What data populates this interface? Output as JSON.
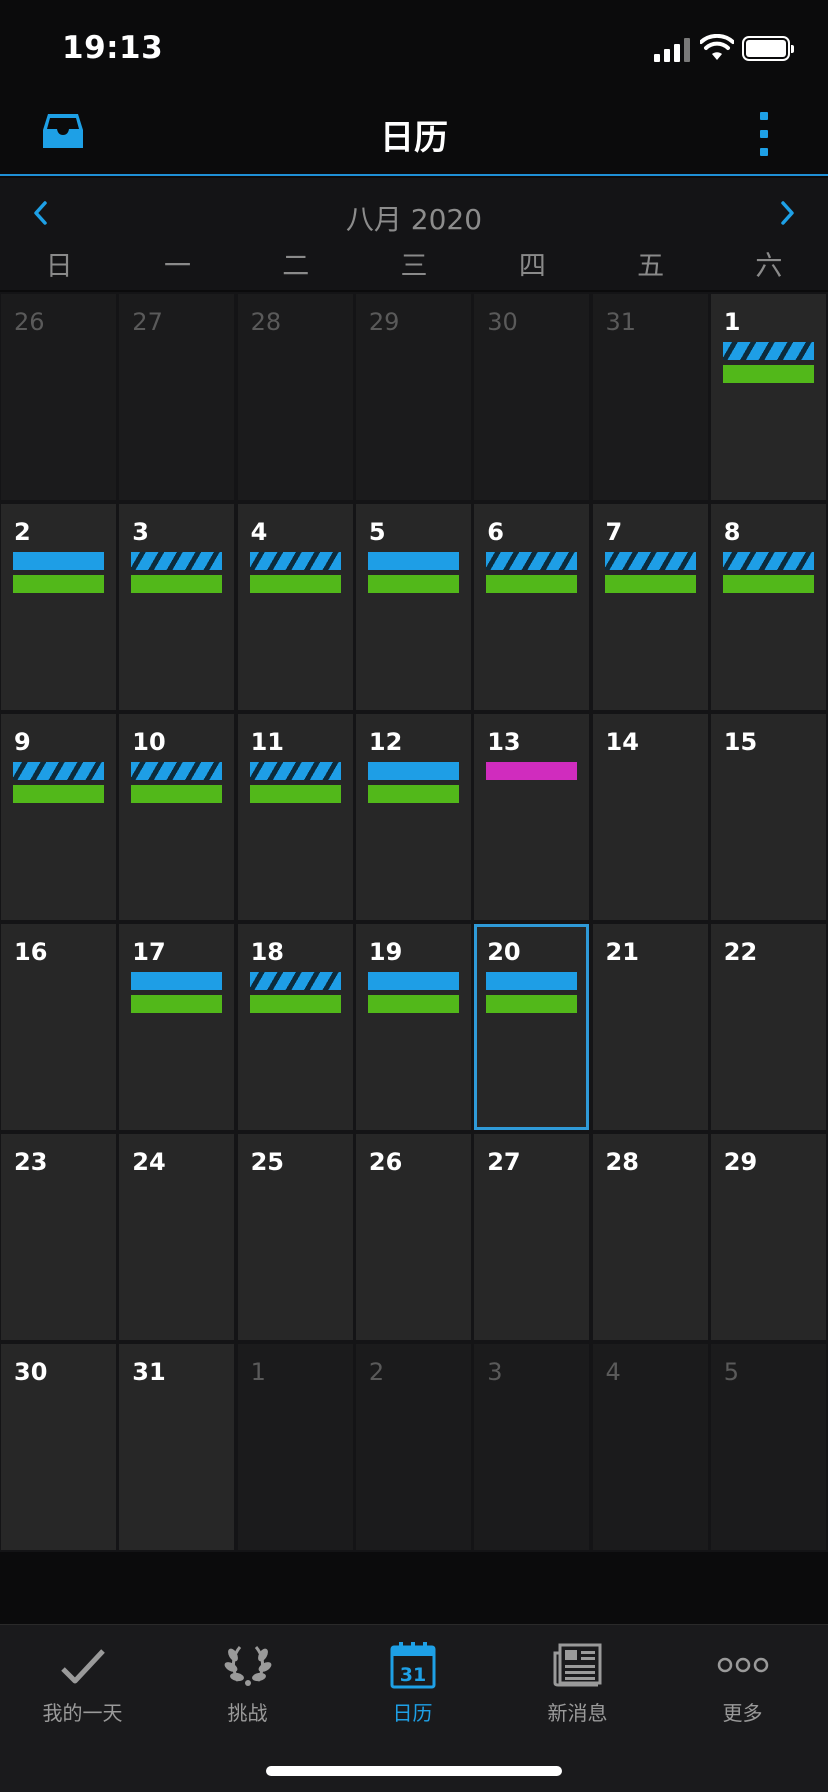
{
  "status": {
    "time": "19:13"
  },
  "header": {
    "title": "日历",
    "left_icon": "inbox-icon",
    "right_icon": "more-vert-icon"
  },
  "month_nav": {
    "label": "八月 2020"
  },
  "weekdays": [
    "日",
    "一",
    "二",
    "三",
    "四",
    "五",
    "六"
  ],
  "colors": {
    "accent": "#1ea0e6",
    "green": "#52b81a",
    "pink": "#d02cbe",
    "cell": "#272727",
    "cell_other": "#1b1b1c"
  },
  "calendar": {
    "today": "20",
    "days": [
      {
        "d": "26",
        "other": true,
        "bars": []
      },
      {
        "d": "27",
        "other": true,
        "bars": []
      },
      {
        "d": "28",
        "other": true,
        "bars": []
      },
      {
        "d": "29",
        "other": true,
        "bars": []
      },
      {
        "d": "30",
        "other": true,
        "bars": []
      },
      {
        "d": "31",
        "other": true,
        "bars": []
      },
      {
        "d": "1",
        "bars": [
          "stripe",
          "green"
        ]
      },
      {
        "d": "2",
        "bars": [
          "solid",
          "green"
        ]
      },
      {
        "d": "3",
        "bars": [
          "stripe",
          "green"
        ]
      },
      {
        "d": "4",
        "bars": [
          "stripe",
          "green"
        ]
      },
      {
        "d": "5",
        "bars": [
          "solid",
          "green"
        ]
      },
      {
        "d": "6",
        "bars": [
          "stripe",
          "green"
        ]
      },
      {
        "d": "7",
        "bars": [
          "stripe",
          "green"
        ]
      },
      {
        "d": "8",
        "bars": [
          "stripe",
          "green"
        ]
      },
      {
        "d": "9",
        "bars": [
          "stripe",
          "green"
        ]
      },
      {
        "d": "10",
        "bars": [
          "stripe",
          "green"
        ]
      },
      {
        "d": "11",
        "bars": [
          "stripe",
          "green"
        ]
      },
      {
        "d": "12",
        "bars": [
          "solid",
          "green"
        ]
      },
      {
        "d": "13",
        "bars": [
          "pink"
        ]
      },
      {
        "d": "14",
        "bars": []
      },
      {
        "d": "15",
        "bars": []
      },
      {
        "d": "16",
        "bars": []
      },
      {
        "d": "17",
        "bars": [
          "solid",
          "green"
        ]
      },
      {
        "d": "18",
        "bars": [
          "stripe",
          "green"
        ]
      },
      {
        "d": "19",
        "bars": [
          "solid",
          "green"
        ]
      },
      {
        "d": "20",
        "today": true,
        "bars": [
          "solid",
          "green"
        ]
      },
      {
        "d": "21",
        "bars": []
      },
      {
        "d": "22",
        "bars": []
      },
      {
        "d": "23",
        "bars": []
      },
      {
        "d": "24",
        "bars": []
      },
      {
        "d": "25",
        "bars": []
      },
      {
        "d": "26",
        "bars": []
      },
      {
        "d": "27",
        "bars": []
      },
      {
        "d": "28",
        "bars": []
      },
      {
        "d": "29",
        "bars": []
      },
      {
        "d": "30",
        "bars": []
      },
      {
        "d": "31",
        "bars": []
      },
      {
        "d": "1",
        "other": true,
        "bars": []
      },
      {
        "d": "2",
        "other": true,
        "bars": []
      },
      {
        "d": "3",
        "other": true,
        "bars": []
      },
      {
        "d": "4",
        "other": true,
        "bars": []
      },
      {
        "d": "5",
        "other": true,
        "bars": []
      }
    ]
  },
  "tabs": [
    {
      "label": "我的一天",
      "icon": "checkmark-icon",
      "active": false
    },
    {
      "label": "挑战",
      "icon": "laurel-icon",
      "active": false
    },
    {
      "label": "日历",
      "icon": "calendar-icon",
      "active": true,
      "icon_text": "31"
    },
    {
      "label": "新消息",
      "icon": "newspaper-icon",
      "active": false
    },
    {
      "label": "更多",
      "icon": "more-dots-icon",
      "active": false
    }
  ]
}
